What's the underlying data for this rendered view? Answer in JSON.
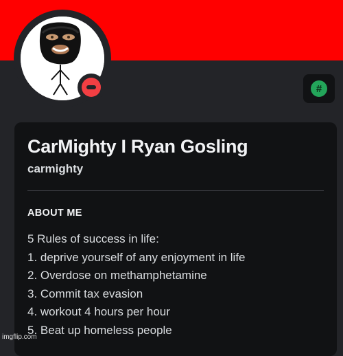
{
  "profile": {
    "display_name": "CarMighty I Ryan Gosling",
    "username": "carmighty",
    "status": "do-not-disturb",
    "banner_color": "#ff0000",
    "status_color": "#f23f43"
  },
  "badge": {
    "icon": "hashtag-icon",
    "symbol": "#",
    "color": "#23a55a"
  },
  "about": {
    "title": "ABOUT ME",
    "lines": [
      "5 Rules of success in life:",
      "1. deprive yourself of any enjoyment in life",
      "2. Overdose on methamphetamine",
      "3. Commit tax evasion",
      "4. workout 4 hours per hour",
      "5. Beat up homeless people"
    ]
  },
  "watermark": "imgflip.com"
}
